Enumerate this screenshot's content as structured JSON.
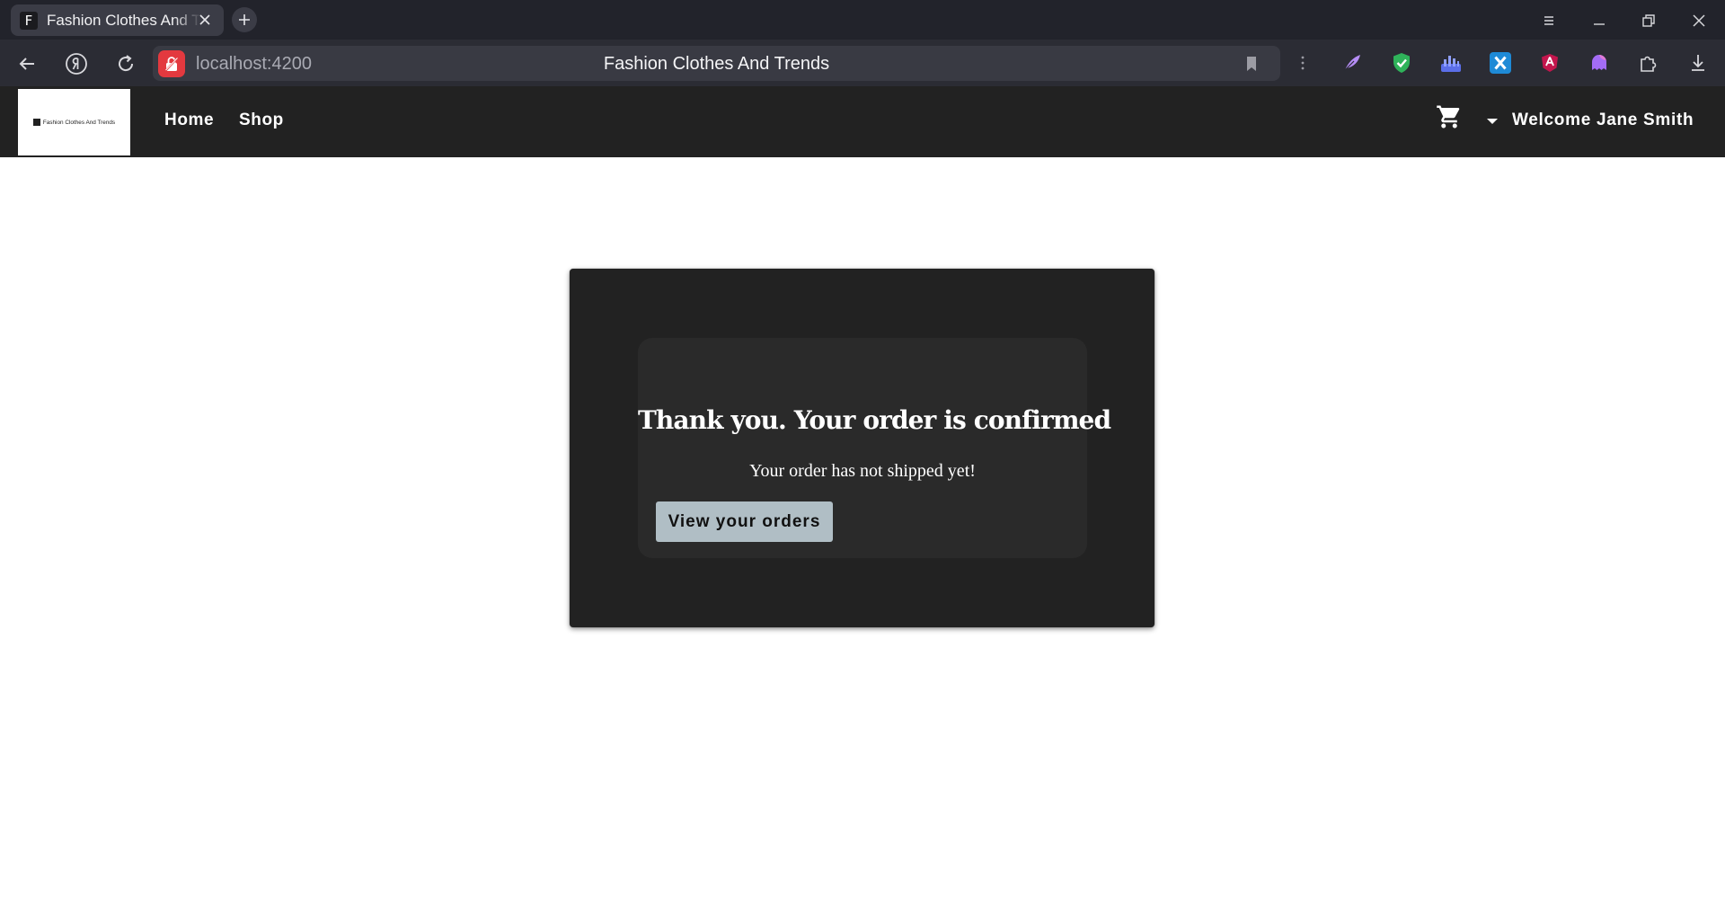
{
  "browser": {
    "tab": {
      "favicon_letter": "F",
      "title": "Fashion Clothes And Trends"
    },
    "url": "localhost:4200",
    "page_title": "Fashion Clothes And Trends",
    "extensions": [
      "feather-extension-icon",
      "shield-check-extension-icon",
      "chart-extension-icon",
      "x-extension-icon",
      "angular-extension-icon",
      "ghost-extension-icon",
      "puzzle-icon",
      "download-icon"
    ]
  },
  "site_nav": {
    "logo_text": "Fashion Clothes And Trends",
    "links": [
      {
        "label": "Home"
      },
      {
        "label": "Shop"
      }
    ],
    "user_greeting": "Welcome Jane Smith"
  },
  "confirmation": {
    "title": "Thank you. Your order is confirmed",
    "subtitle": "Your order has not shipped yet!",
    "button_label": "View your orders"
  },
  "colors": {
    "nav_bg": "#222222",
    "card_bg": "#222222",
    "inner_card_bg": "#2a2a2a",
    "button_bg": "#b0bec5",
    "lock_red": "#e3393f"
  }
}
